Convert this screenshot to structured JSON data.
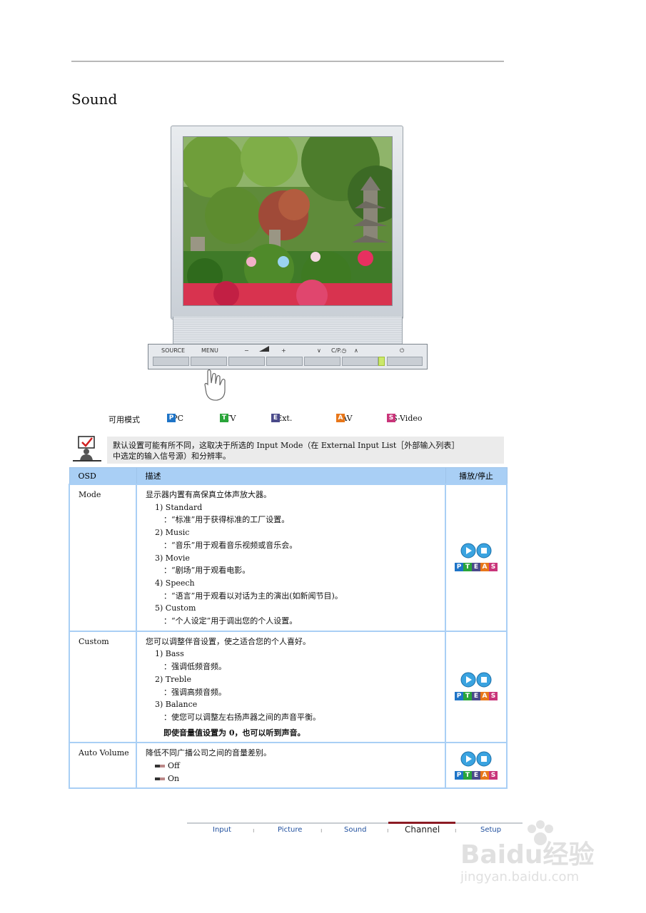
{
  "page": {
    "title": "Sound"
  },
  "control_panel": {
    "source": "SOURCE",
    "menu": "MENU",
    "minus": "−",
    "plus": "+",
    "down": "∨",
    "cp": "C/P.◷",
    "up": "∧",
    "power": "⏻"
  },
  "modes": {
    "label": "可用模式",
    "items": [
      {
        "badge": "P",
        "text": ": PC",
        "color": "#1e74c7"
      },
      {
        "badge": "T",
        "text": ": TV",
        "color": "#2aa53a"
      },
      {
        "badge": "E",
        "text": ": Ext.",
        "color": "#4a4a8a"
      },
      {
        "badge": "A",
        "text": ": AV",
        "color": "#e8771a"
      },
      {
        "badge": "S",
        "text": ": S-Video",
        "color": "#c9357a"
      }
    ]
  },
  "note": {
    "line1": "默认设置可能有所不同，这取决于所选的 Input Mode（在 External Input List［外部输入列表］",
    "line2": "中选定的输入信号源）和分辨率。"
  },
  "table": {
    "headers": [
      "OSD",
      "描述",
      "播放/停止"
    ],
    "rows": [
      {
        "osd": "Mode",
        "intro": "显示器内置有高保真立体声放大器。",
        "lines": [
          {
            "t": "1) Standard",
            "k": "it"
          },
          {
            "t": "：“标准”用于获得标准的工厂设置。",
            "k": "sub"
          },
          {
            "t": "2) Music",
            "k": "it"
          },
          {
            "t": "：“音乐”用于观看音乐视频或音乐会。",
            "k": "sub"
          },
          {
            "t": "3) Movie",
            "k": "it"
          },
          {
            "t": "：“剧场”用于观看电影。",
            "k": "sub"
          },
          {
            "t": "4) Speech",
            "k": "it"
          },
          {
            "t": "：“语言”用于观看以对话为主的演出(如新闻节目)。",
            "k": "sub"
          },
          {
            "t": "5) Custom",
            "k": "it"
          },
          {
            "t": "：“个人设定”用于调出您的个人设置。",
            "k": "sub"
          }
        ]
      },
      {
        "osd": "Custom",
        "intro": "您可以调整伴音设置，使之适合您的个人喜好。",
        "lines": [
          {
            "t": "1) Bass",
            "k": "it"
          },
          {
            "t": "：强调低频音频。",
            "k": "sub"
          },
          {
            "t": "2) Treble",
            "k": "it"
          },
          {
            "t": "：强调高频音频。",
            "k": "sub"
          },
          {
            "t": "3) Balance",
            "k": "it"
          },
          {
            "t": "：使您可以调整左右扬声器之间的声音平衡。",
            "k": "sub"
          },
          {
            "t": "即使音量值设置为 0，也可以听到声音。",
            "k": "bold"
          }
        ]
      },
      {
        "osd": "Auto Volume",
        "intro": "降低不同广播公司之间的音量差别。",
        "lines": [
          {
            "t": "Off",
            "k": "opt"
          },
          {
            "t": "On",
            "k": "opt"
          }
        ]
      }
    ],
    "pteas": [
      "P",
      "T",
      "E",
      "A",
      "S"
    ]
  },
  "nav": {
    "items": [
      "Input",
      "Picture",
      "Sound",
      "Channel",
      "Setup"
    ],
    "selected": "Channel"
  },
  "watermark": {
    "brand": "Baidu经验",
    "url": "jingyan.baidu.com"
  }
}
